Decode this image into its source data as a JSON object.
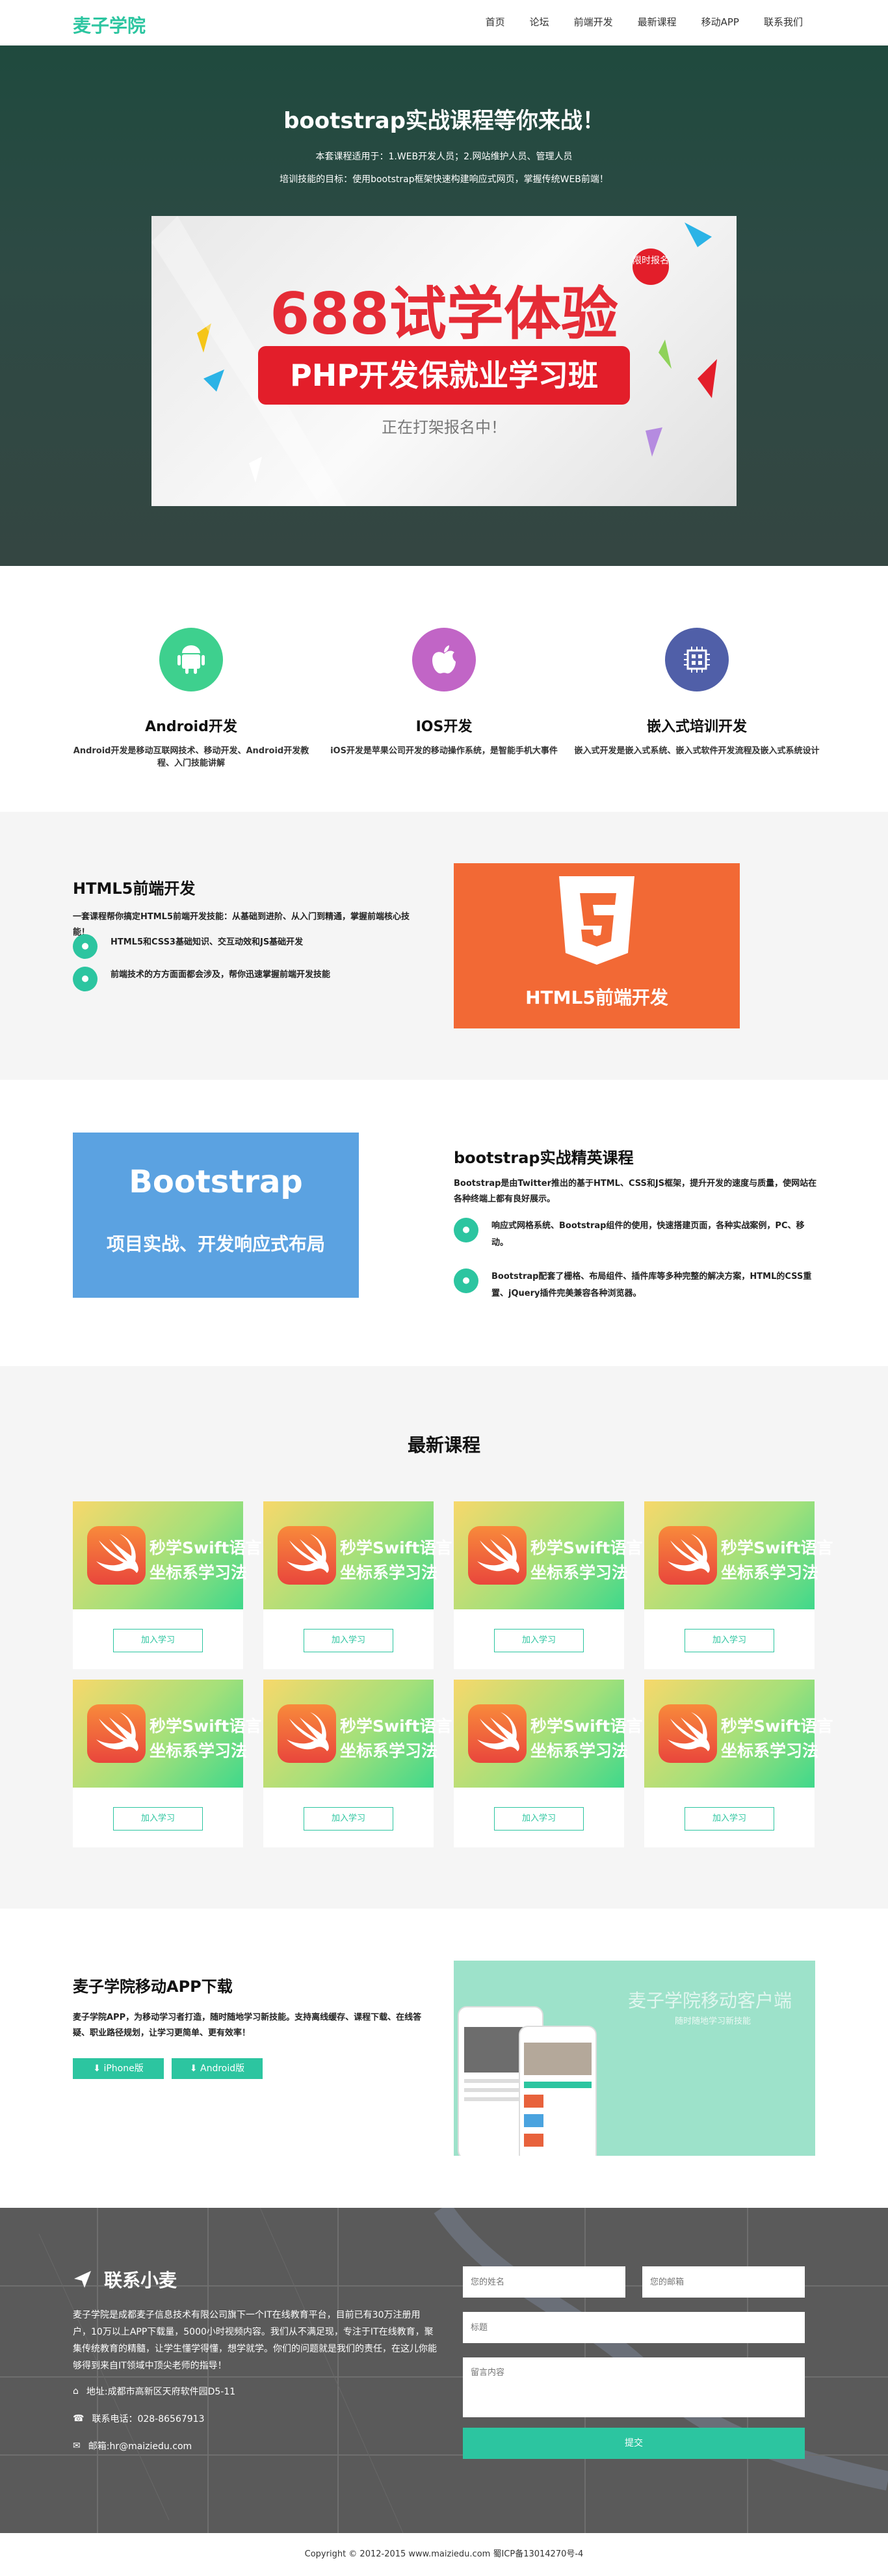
{
  "nav": {
    "brand": "麦子学院",
    "items": [
      "首页",
      "论坛",
      "前端开发",
      "最新课程",
      "移动APP",
      "联系我们"
    ]
  },
  "hero": {
    "title": "bootstrap实战课程等你来战！",
    "sub1": "本套课程适用于：1.WEB开发人员；2.网站维护人员、管理人员",
    "sub2": "培训技能的目标：使用bootstrap框架快速构建响应式网页，掌握传统WEB前端！",
    "banner_big": "688试学体验",
    "banner_red": "PHP开发保就业学习班",
    "banner_small": "正在打架报名中！",
    "badge": "限时报名"
  },
  "features": [
    {
      "title": "Android开发",
      "desc": "Android开发是移动互联网技术、移动开发、Android开发教程、入门技能讲解",
      "color": "#3ed08e",
      "icon": "android-icon"
    },
    {
      "title": "IOS开发",
      "desc": "iOS开发是苹果公司开发的移动操作系统，是智能手机大事件",
      "color": "#c165c6",
      "icon": "apple-icon"
    },
    {
      "title": "嵌入式培训开发",
      "desc": "嵌入式开发是嵌入式系统、嵌入式软件开发流程及嵌入式系统设计",
      "color": "#505fa8",
      "icon": "chip-icon"
    }
  ],
  "html5": {
    "title": "HTML5前端开发",
    "desc": "一套课程帮你搞定HTML5前端开发技能：从基础到进阶、从入门到精通，掌握前端核心技能！",
    "bullets": [
      "HTML5和CSS3基础知识、交互动效和JS基础开发",
      "前端技术的方方面面都会涉及，帮你迅速掌握前端开发技能"
    ],
    "image_label": "HTML5前端开发"
  },
  "bootstrap": {
    "title": "bootstrap实战精英课程",
    "desc": "Bootstrap是由Twitter推出的基于HTML、CSS和JS框架，提升开发的速度与质量，使网站在各种终端上都有良好展示。",
    "bullets": [
      "响应式网格系统、Bootstrap组件的使用，快速搭建页面，各种实战案例，PC、移动。",
      "Bootstrap配套了栅格、布局组件、插件库等多种完整的解决方案，HTML的CSS重置、jQuery插件完美兼容各种浏览器。"
    ],
    "image_t1": "Bootstrap",
    "image_t2": "项目实战、开发响应式布局"
  },
  "courses": {
    "title": "最新课程",
    "card_line1": "秒学Swift语言",
    "card_line2": "坐标系学习法",
    "join_label": "加入学习",
    "count": 8
  },
  "app": {
    "title": "麦子学院移动APP下载",
    "desc": "麦子学院APP，为移动学习者打造，随时随地学习新技能。支持离线缓存、课程下载、在线答疑、职业路径规划，让学习更简单、更有效率！",
    "iphone": "iPhone版",
    "android": "Android版",
    "image_t1": "麦子学院移动客户端",
    "image_t2": "随时随地学习新技能"
  },
  "contact": {
    "title": "联系小麦",
    "desc": "麦子学院是成都麦子信息技术有限公司旗下一个IT在线教育平台，目前已有30万注册用户，10万以上APP下载量，5000小时视频内容。我们从不满足现，专注于IT在线教育，聚集传统教育的精髓，让学生懂学得懂，想学就学。你们的问题就是我们的责任，在这儿你能够得到来自IT领域中顶尖老师的指导！",
    "address": "地址:成都市高新区天府软件园D5-11",
    "phone": "联系电话：028-86567913",
    "email": "邮箱:hr@maiziedu.com",
    "name_ph": "您的姓名",
    "email_ph": "您的邮箱",
    "subject_ph": "标题",
    "message_ph": "留言内容",
    "submit": "提交"
  },
  "footer": {
    "text": "Copyright © 2012-2015  www.maiziedu.com  蜀ICP备13014270号-4"
  },
  "colors": {
    "accent": "#2cc5a0",
    "hero_bg": "#2d4a44"
  }
}
